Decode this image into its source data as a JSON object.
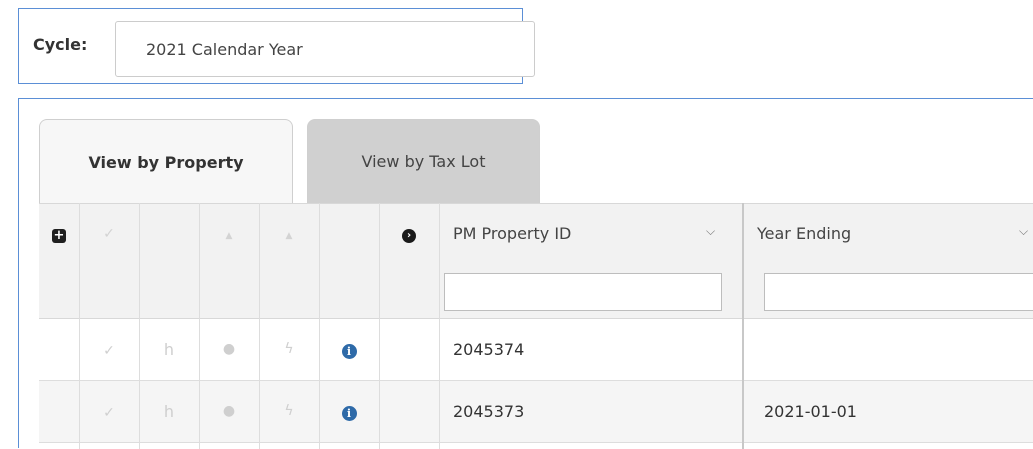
{
  "cycle": {
    "label": "Cycle:",
    "selected": "2021 Calendar Year"
  },
  "tabs": [
    {
      "label": "View by Property",
      "active": true
    },
    {
      "label": "View by Tax Lot",
      "active": false
    }
  ],
  "grid": {
    "header_icons": {
      "add": "plus-square-icon",
      "select_all": "check-icon",
      "sort_up_1": "caret-up-icon",
      "sort_up_2": "caret-up-icon",
      "expand": "chevron-circle-right-icon"
    },
    "columns": [
      {
        "title": "PM Property ID",
        "filter_value": ""
      },
      {
        "title": "Year Ending",
        "filter_value": ""
      }
    ],
    "rows": [
      {
        "pm_property_id": "2045374",
        "year_ending": ""
      },
      {
        "pm_property_id": "2045373",
        "year_ending": "2021-01-01"
      }
    ],
    "row_icons": [
      "check-icon",
      "history-icon",
      "comment-icon",
      "bolt-icon",
      "info-circle-icon"
    ]
  },
  "colors": {
    "panel_border": "#5b8fd6",
    "info_icon": "#2e6aa8",
    "inactive_tab": "#d0d0d0"
  }
}
